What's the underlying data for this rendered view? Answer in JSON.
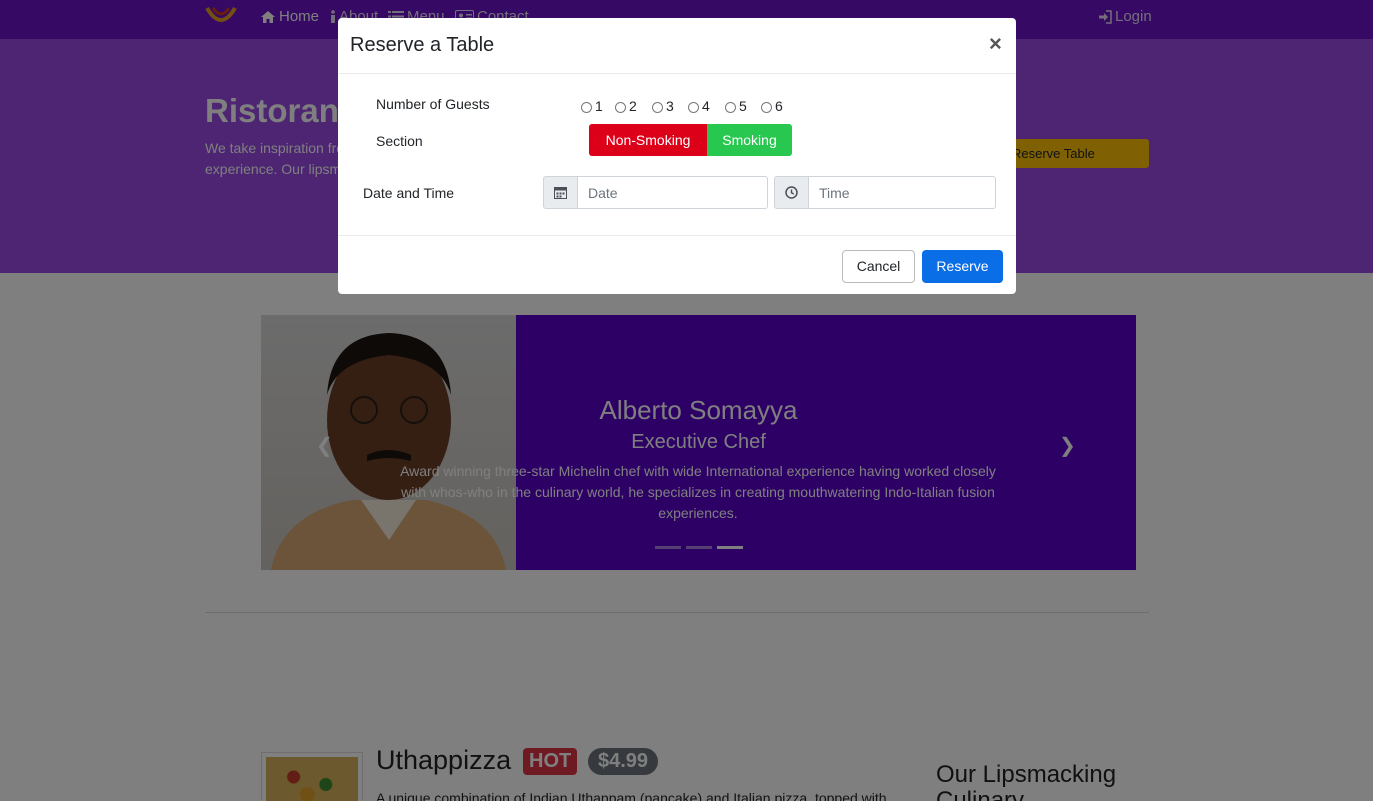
{
  "navbar": {
    "home_label": "Home",
    "about_label": "About",
    "menu_label": "Menu",
    "contact_label": "Contact",
    "login_label": "Login"
  },
  "jumbotron": {
    "title": "Ristorante",
    "text": "We take inspiration from the World's best cuisines, and create a unique fusion experience. Our lipsmacking creations will tickle your culinary senses!",
    "reserve_label": "Reserve Table"
  },
  "carousel": {
    "name": "Alberto Somayya",
    "designation": "Executive Chef",
    "description": "Award winning three-star Michelin chef with wide International experience having worked closely with whos-who in the culinary world, he specializes in creating mouthwatering Indo-Italian fusion experiences.",
    "active_slide": 3,
    "slide_count": 3
  },
  "dish": {
    "name": "Uthappizza",
    "badge": "HOT",
    "price": "$4.99",
    "description": "A unique combination of Indian Uthappam (pancake) and Italian pizza, topped with"
  },
  "sidebar": {
    "heading": "Our Lipsmacking Culinary"
  },
  "modal": {
    "title": "Reserve a Table",
    "close_label": "×",
    "guests_label": "Number of Guests",
    "guest_options": [
      "1",
      "2",
      "3",
      "4",
      "5",
      "6"
    ],
    "section_label": "Section",
    "non_smoking_label": "Non-Smoking",
    "smoking_label": "Smoking",
    "datetime_label": "Date and Time",
    "date_placeholder": "Date",
    "time_placeholder": "Time",
    "cancel_label": "Cancel",
    "reserve_label": "Reserve"
  },
  "colors": {
    "navbar": "#6a12c9",
    "jumbotron": "#9b4ae6",
    "non_smoking": "#dc0019",
    "smoking": "#28c850",
    "primary": "#0a6ee6",
    "hot": "#dc3545"
  }
}
